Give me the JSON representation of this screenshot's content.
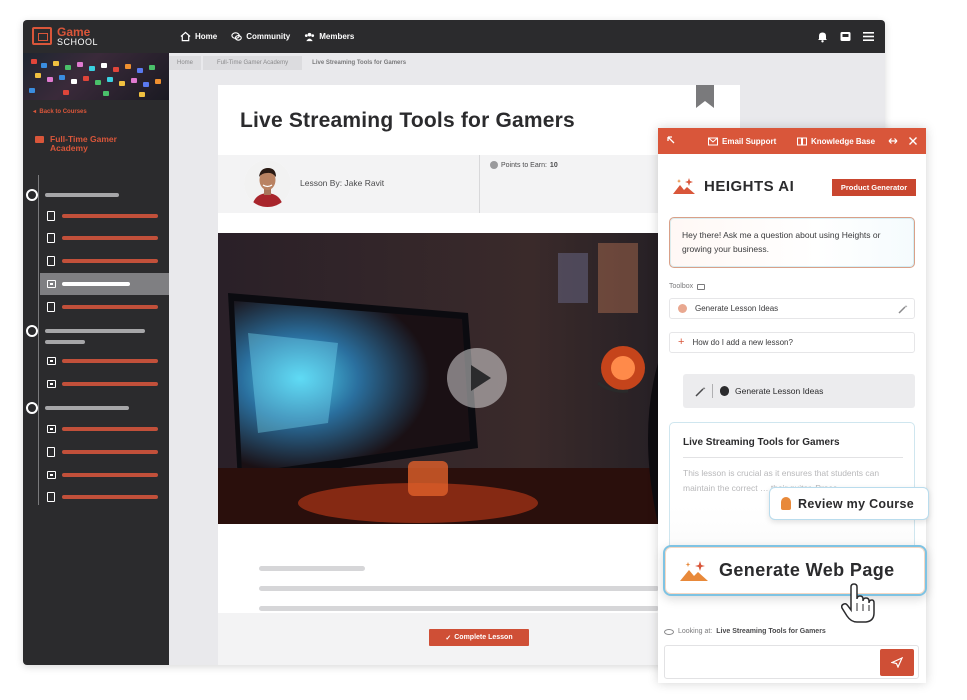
{
  "brand": {
    "logo_line1": "Game",
    "logo_line2": "SCHOOL"
  },
  "topnav": [
    {
      "label": "Home",
      "icon": "home-icon"
    },
    {
      "label": "Community",
      "icon": "chat-icon"
    },
    {
      "label": "Members",
      "icon": "users-icon"
    }
  ],
  "sidebar": {
    "back_label": "Back to Courses",
    "course_title": "Full-Time Gamer Academy"
  },
  "breadcrumbs": [
    "Home",
    "Full-Time Gamer Academy",
    "Live Streaming Tools for Gamers"
  ],
  "lesson": {
    "title": "Live Streaming Tools for Gamers",
    "author": "Lesson By: Jake Ravit",
    "points_label": "Points to Earn:",
    "points_value": "10",
    "complete_label": "Complete Lesson"
  },
  "ai_panel": {
    "email_support": "Email Support",
    "knowledge_base": "Knowledge Base",
    "brand_name": "HEIGHTS AI",
    "badge": "Product Generator",
    "greeting": "Hey there! Ask me a question about using Heights or growing your business.",
    "toolbox_label": "Toolbox",
    "tools": [
      "Generate Lesson Ideas",
      "How do I add a new lesson?"
    ],
    "generate_button": "Generate Lesson Ideas",
    "result_title": "Live Streaming Tools for Gamers",
    "result_text": "This lesson is crucial as it ensures that students can maintain the correct … their guitar. Proce…",
    "looking_label": "Looking at:",
    "looking_value": "Live Streaming Tools for Gamers"
  },
  "floating": {
    "review_label": "Review my Course",
    "generate_label": "Generate Web Page"
  },
  "colors": {
    "accent": "#d9563a",
    "dark": "#2b2b2d",
    "highlight_border": "#7ec3e3"
  }
}
